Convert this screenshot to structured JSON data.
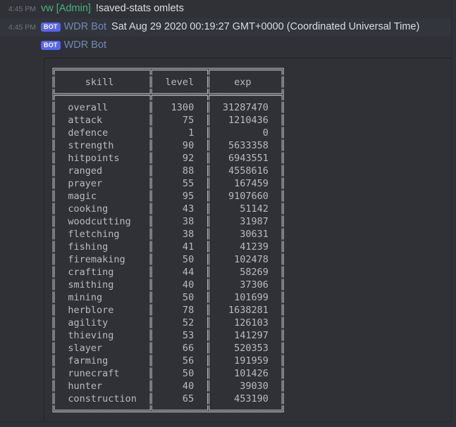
{
  "messages": [
    {
      "timestamp": "4:45 PM",
      "author": "vw [Admin]",
      "author_color": "#43b581",
      "is_bot": false,
      "text": "!saved-stats omlets"
    },
    {
      "timestamp": "4:45 PM",
      "author": "WDR Bot",
      "author_color": "#7289b8",
      "is_bot": true,
      "bot_tag": "BOT",
      "text": "Sat Aug 29 2020 00:19:27 GMT+0000 (Coordinated Universal Time)"
    },
    {
      "timestamp": "4:45 PM",
      "author": "WDR Bot",
      "author_color": "#7289b8",
      "is_bot": true,
      "bot_tag": "BOT",
      "text": ""
    }
  ],
  "stats_table": {
    "headers": [
      "skill",
      "level",
      "exp"
    ],
    "rows": [
      [
        "overall",
        "1300",
        "31287470"
      ],
      [
        "attack",
        "75",
        "1210436"
      ],
      [
        "defence",
        "1",
        "0"
      ],
      [
        "strength",
        "90",
        "5633358"
      ],
      [
        "hitpoints",
        "92",
        "6943551"
      ],
      [
        "ranged",
        "88",
        "4558616"
      ],
      [
        "prayer",
        "55",
        "167459"
      ],
      [
        "magic",
        "95",
        "9107660"
      ],
      [
        "cooking",
        "43",
        "51142"
      ],
      [
        "woodcutting",
        "38",
        "31987"
      ],
      [
        "fletching",
        "38",
        "30631"
      ],
      [
        "fishing",
        "41",
        "41239"
      ],
      [
        "firemaking",
        "50",
        "102478"
      ],
      [
        "crafting",
        "44",
        "58269"
      ],
      [
        "smithing",
        "40",
        "37306"
      ],
      [
        "mining",
        "50",
        "101699"
      ],
      [
        "herblore",
        "78",
        "1638281"
      ],
      [
        "agility",
        "52",
        "126103"
      ],
      [
        "thieving",
        "53",
        "141297"
      ],
      [
        "slayer",
        "66",
        "520353"
      ],
      [
        "farming",
        "56",
        "191959"
      ],
      [
        "runecraft",
        "50",
        "101426"
      ],
      [
        "hunter",
        "40",
        "39030"
      ],
      [
        "construction",
        "65",
        "453190"
      ]
    ]
  }
}
